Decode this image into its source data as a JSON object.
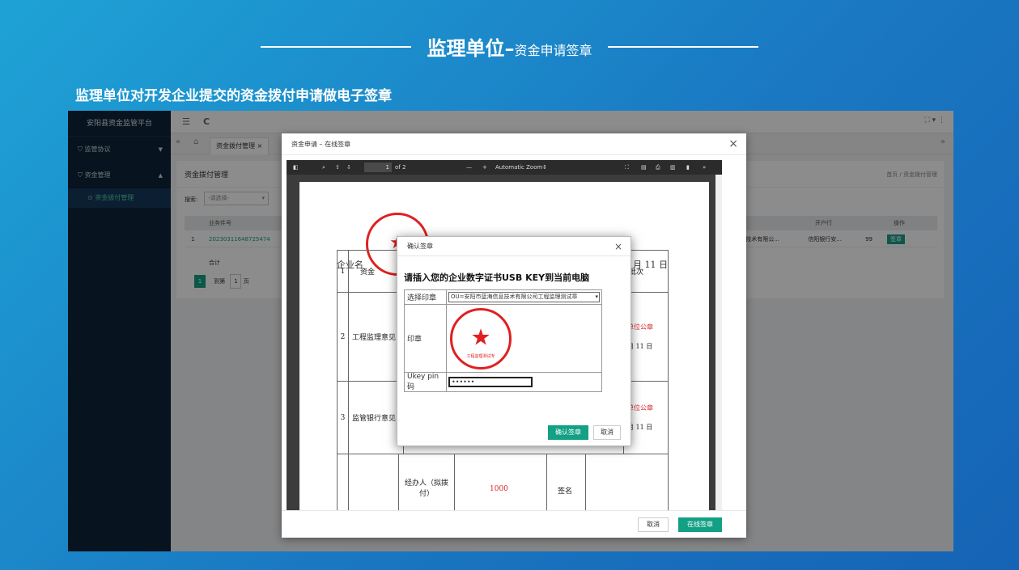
{
  "slide": {
    "title_main": "监理单位",
    "title_sep": "–",
    "title_sub": "资金申请签章",
    "subtitle": "监理单位对开发企业提交的资金拨付申请做电子签章"
  },
  "app": {
    "brand": "安阳县资金监管平台",
    "sidebar": {
      "items": [
        {
          "label": "监管协议"
        },
        {
          "label": "资金管理"
        }
      ],
      "subitem": "资金拨付管理"
    },
    "topbar": {
      "menu_icon": "☰",
      "refresh_icon": "C",
      "right_icons": "⛶ ▾ ⋮"
    },
    "tabs": {
      "back": "«",
      "home_icon": "⌂",
      "active_tab": "资金拨付管理",
      "forward": "»"
    },
    "page": {
      "title": "资金拨付管理",
      "breadcrumb": "首页 / 资金拨付管理",
      "search_label": "搜索:",
      "search_placeholder": "-请选择-",
      "columns": {
        "col1": "业务件号",
        "col_bank": "开户行",
        "col_op": "操作"
      },
      "row": {
        "index": "1",
        "case_no": "20230311648725474",
        "company": "技术有限公...",
        "bank": "信阳银行安...",
        "num": "99",
        "op": "签章"
      },
      "total_label": "合计",
      "pagination": {
        "page": "1",
        "goto": "到第",
        "page_box": "1",
        "page_unit": "页"
      }
    }
  },
  "modal": {
    "title": "资金申请 – 在线签章",
    "close": "×",
    "pdf_toolbar": {
      "page_input": "1",
      "page_total": "of 2",
      "zoom": "Automatic Zoom"
    },
    "doc": {
      "company_label": "企业名",
      "date_tail": "月 11 日",
      "col_batch": "批次",
      "rows": [
        {
          "no": "1",
          "label": "资金"
        },
        {
          "no": "2",
          "label": "工程监理意见",
          "seal_text": "单位公章",
          "date": "月 11 日"
        },
        {
          "no": "3",
          "label": "监管银行意见",
          "seal_text": "单位公章",
          "date": "月 11 日"
        }
      ],
      "last_row": {
        "label": "经办人（拟拨付）",
        "amount": "1000",
        "sign": "签名"
      }
    },
    "cancel": "取消",
    "confirm": "在线签章"
  },
  "dialog": {
    "title": "确认签章",
    "close": "×",
    "prompt": "请插入您的企业数字证书USB KEY到当前电脑",
    "select_label": "选择印章",
    "select_value": "OU=安阳市蓝海信息技术有限公司工程监理测试章",
    "seal_label": "印章",
    "seal_bottom_text": "工程监理测试专",
    "pin_label": "Ukey pin码",
    "pin_value": "••••••",
    "confirm": "确认签章",
    "cancel": "取消"
  },
  "colors": {
    "accent": "#14a085",
    "sidebar": "#0e2437",
    "seal_red": "#e02020"
  }
}
